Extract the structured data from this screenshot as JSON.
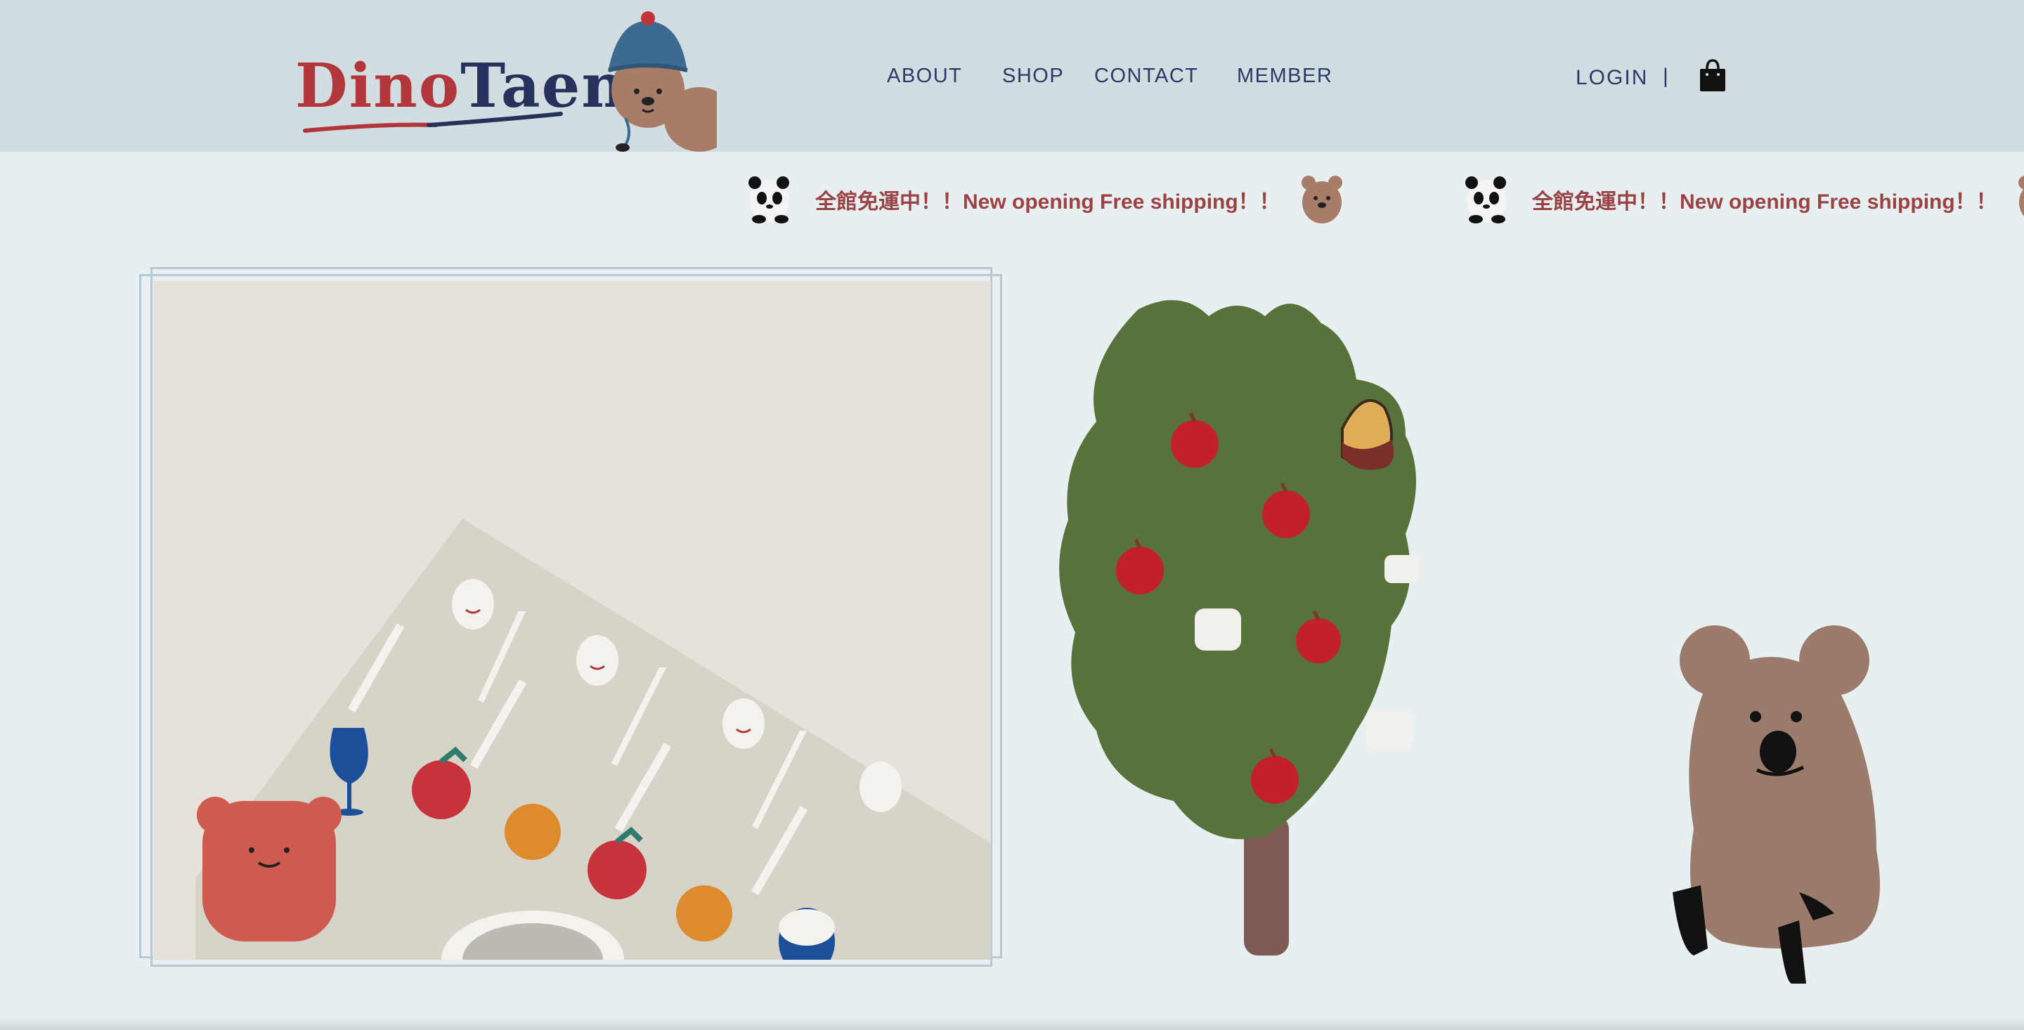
{
  "brand": {
    "logo_part1": "Dino",
    "logo_part2": "Taeng",
    "logo_icon": "quokka-in-beanie-illustration",
    "colors": {
      "red": "#b2373a",
      "navy": "#26325c",
      "header_bg": "#d1dde1",
      "page_bg": "#e8eff0"
    }
  },
  "nav": {
    "items": [
      {
        "label": "ABOUT"
      },
      {
        "label": "SHOP"
      },
      {
        "label": "CONTACT"
      },
      {
        "label": "MEMBER"
      }
    ],
    "login_label": "LOGIN",
    "separator": "|",
    "cart_icon": "shopping-bag-icon"
  },
  "announcement": {
    "text": "全館免運中！！New opening Free shipping！！",
    "icons": [
      "panda-icon",
      "quokka-icon"
    ],
    "text_color": "#9b4245"
  },
  "hero": {
    "photo_subject": "sticker-sheet-photo",
    "illustrations": [
      "apple-tree-illustration",
      "quokka-illustration"
    ]
  }
}
